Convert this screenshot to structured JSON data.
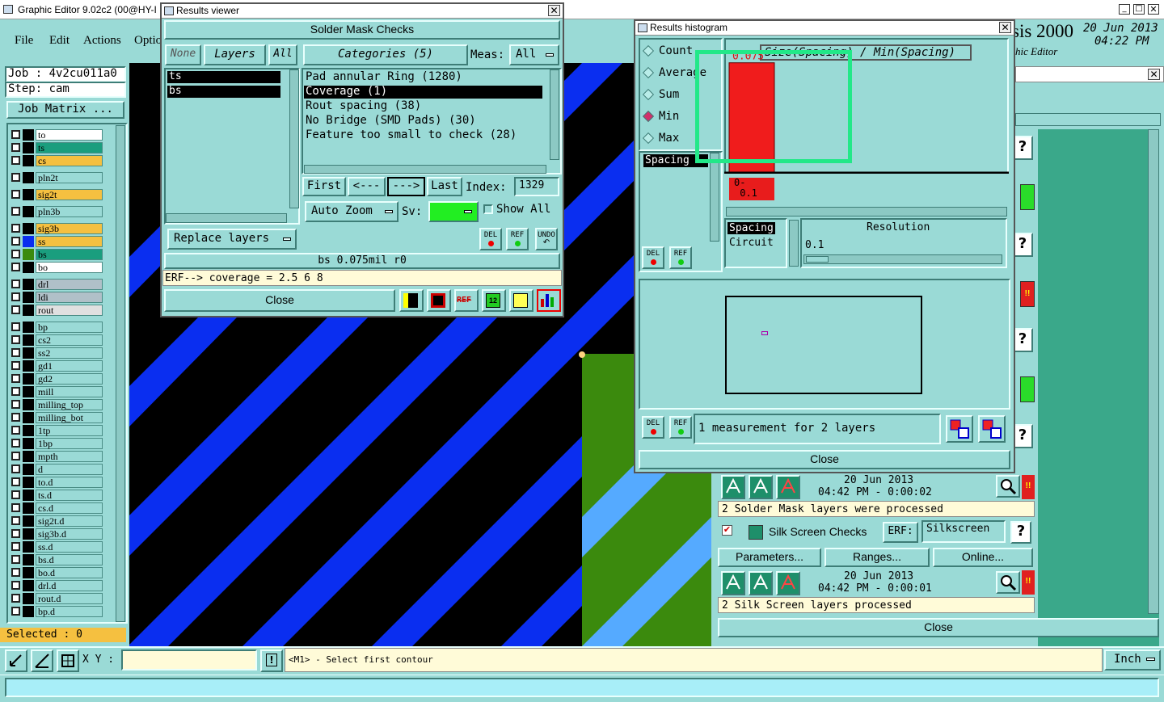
{
  "main_window": {
    "title": "Graphic Editor 9.02c2 (00@HY-I",
    "menu": [
      "File",
      "Edit",
      "Actions",
      "Optio"
    ]
  },
  "job_panel": {
    "job_label": "Job : 4v2cu011a0",
    "step_label": "Step: cam",
    "matrix_button": "Job Matrix ...",
    "selected": "Selected : 0"
  },
  "layers": [
    {
      "name": "to",
      "color": "#ffffff"
    },
    {
      "name": "ts",
      "color": "#1a9e7e"
    },
    {
      "name": "cs",
      "color": "#f5c040"
    },
    {
      "name": "pln2t",
      "color": "#9adad6"
    },
    {
      "name": "sig2t",
      "color": "#f5c040"
    },
    {
      "name": "pln3b",
      "color": "#9adad6"
    },
    {
      "name": "sig3b",
      "color": "#f5c040"
    },
    {
      "name": "ss",
      "color": "#f5c040"
    },
    {
      "name": "bs",
      "color": "#1a9e7e"
    },
    {
      "name": "bo",
      "color": "#ffffff"
    },
    {
      "name": "drl",
      "color": "#b0c0c8"
    },
    {
      "name": "ldi",
      "color": "#b0c0c8"
    },
    {
      "name": "rout",
      "color": "#e0e0e0"
    },
    {
      "name": "bp",
      "color": "#9adad6"
    },
    {
      "name": "cs2",
      "color": "#9adad6"
    },
    {
      "name": "ss2",
      "color": "#9adad6"
    },
    {
      "name": "gd1",
      "color": "#9adad6"
    },
    {
      "name": "gd2",
      "color": "#9adad6"
    },
    {
      "name": "mill",
      "color": "#9adad6"
    },
    {
      "name": "milling_top",
      "color": "#9adad6"
    },
    {
      "name": "milling_bot",
      "color": "#9adad6"
    },
    {
      "name": "1tp",
      "color": "#9adad6"
    },
    {
      "name": "1bp",
      "color": "#9adad6"
    },
    {
      "name": "mpth",
      "color": "#9adad6"
    },
    {
      "name": "d",
      "color": "#9adad6"
    },
    {
      "name": "to.d",
      "color": "#9adad6"
    },
    {
      "name": "ts.d",
      "color": "#9adad6"
    },
    {
      "name": "cs.d",
      "color": "#9adad6"
    },
    {
      "name": "sig2t.d",
      "color": "#9adad6"
    },
    {
      "name": "sig3b.d",
      "color": "#9adad6"
    },
    {
      "name": "ss.d",
      "color": "#9adad6"
    },
    {
      "name": "bs.d",
      "color": "#9adad6"
    },
    {
      "name": "bo.d",
      "color": "#9adad6"
    },
    {
      "name": "drl.d",
      "color": "#9adad6"
    },
    {
      "name": "rout.d",
      "color": "#9adad6"
    },
    {
      "name": "bp.d",
      "color": "#9adad6"
    }
  ],
  "status_bar": {
    "xy_label": "X Y :",
    "hint": "<M1> - Select first contour",
    "unit": "Inch"
  },
  "header_right": {
    "app": "sis 2000",
    "subtitle": "hic Editor",
    "date": "20 Jun 2013",
    "time": "04:22 PM"
  },
  "results_viewer": {
    "title": "Results viewer",
    "heading": "Solder Mask Checks",
    "none": "None",
    "layers": "Layers",
    "all": "All",
    "categories": "Categories (5)",
    "meas_label": "Meas:",
    "meas_value": "All",
    "layer_items": [
      "ts",
      "bs"
    ],
    "category_items": [
      "Pad annular Ring (1280)",
      "Coverage (1)",
      "Rout spacing (38)",
      "No Bridge (SMD Pads) (30)",
      "Feature too small to check (28)"
    ],
    "first": "First",
    "prev": "<---",
    "next": "--->",
    "last": "Last",
    "index_label": "Index:",
    "index_value": "1329",
    "auto_zoom": "Auto Zoom",
    "sv_label": "Sv:",
    "show_all": "Show All",
    "replace_layers": "Replace layers",
    "del": "DEL",
    "ref": "REF",
    "undo": "UNDO",
    "info": "bs 0.075mil  r0",
    "erf": "ERF--> coverage = 2.5 6 8",
    "close": "Close"
  },
  "histogram": {
    "title": "Results histogram",
    "options": [
      "Count",
      "Average",
      "Sum",
      "Min",
      "Max"
    ],
    "selected_option": "Min",
    "header_text": "Size(Spacing) / Min(Spacing)",
    "bar_value": "0.075",
    "bin_label": "0-\n 0.1",
    "spacing_list": [
      "Spacing",
      "Circuit"
    ],
    "spacing_top": "Spacing",
    "resolution_label": "Resolution",
    "resolution_value": "0.1",
    "measurement": "1 measurement for 2 layers",
    "close": "Close",
    "chart_data": {
      "type": "bar",
      "categories": [
        "0-0.1"
      ],
      "values": [
        0.075
      ]
    }
  },
  "check_panel": {
    "run1": {
      "date": "20 Jun 2013",
      "time": "04:42 PM - 0:00:02",
      "message": "2 Solder Mask layers were processed"
    },
    "silk": {
      "label": "Silk Screen Checks",
      "erf": "ERF:",
      "erf_value": "Silkscreen",
      "params": "Parameters...",
      "ranges": "Ranges...",
      "online": "Online..."
    },
    "run2": {
      "date": "20 Jun 2013",
      "time": "04:42 PM - 0:00:01",
      "message": "2 Silk Screen layers processed"
    },
    "close": "Close"
  }
}
